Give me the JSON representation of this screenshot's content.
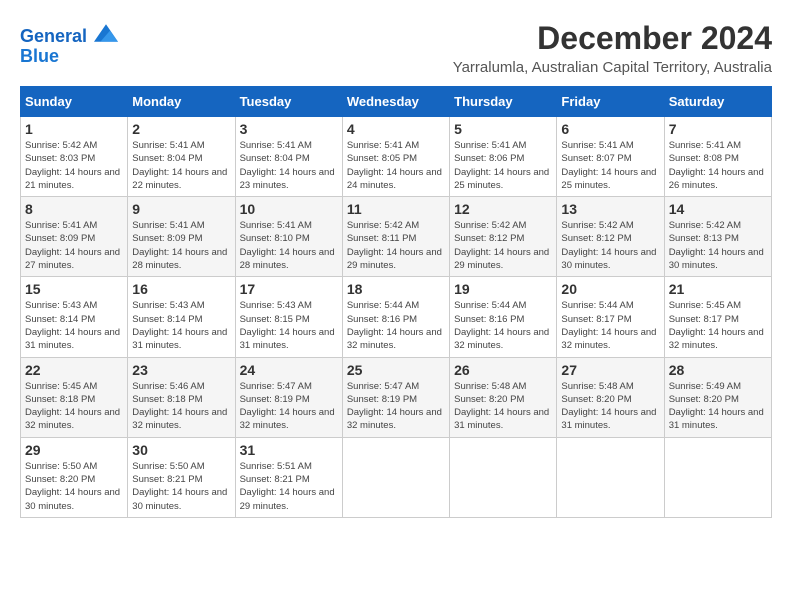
{
  "header": {
    "logo_line1": "General",
    "logo_line2": "Blue",
    "month_title": "December 2024",
    "location": "Yarralumla, Australian Capital Territory, Australia"
  },
  "days_of_week": [
    "Sunday",
    "Monday",
    "Tuesday",
    "Wednesday",
    "Thursday",
    "Friday",
    "Saturday"
  ],
  "weeks": [
    [
      {
        "num": "1",
        "sunrise": "5:42 AM",
        "sunset": "8:03 PM",
        "daylight": "14 hours and 21 minutes."
      },
      {
        "num": "2",
        "sunrise": "5:41 AM",
        "sunset": "8:04 PM",
        "daylight": "14 hours and 22 minutes."
      },
      {
        "num": "3",
        "sunrise": "5:41 AM",
        "sunset": "8:04 PM",
        "daylight": "14 hours and 23 minutes."
      },
      {
        "num": "4",
        "sunrise": "5:41 AM",
        "sunset": "8:05 PM",
        "daylight": "14 hours and 24 minutes."
      },
      {
        "num": "5",
        "sunrise": "5:41 AM",
        "sunset": "8:06 PM",
        "daylight": "14 hours and 25 minutes."
      },
      {
        "num": "6",
        "sunrise": "5:41 AM",
        "sunset": "8:07 PM",
        "daylight": "14 hours and 25 minutes."
      },
      {
        "num": "7",
        "sunrise": "5:41 AM",
        "sunset": "8:08 PM",
        "daylight": "14 hours and 26 minutes."
      }
    ],
    [
      {
        "num": "8",
        "sunrise": "5:41 AM",
        "sunset": "8:09 PM",
        "daylight": "14 hours and 27 minutes."
      },
      {
        "num": "9",
        "sunrise": "5:41 AM",
        "sunset": "8:09 PM",
        "daylight": "14 hours and 28 minutes."
      },
      {
        "num": "10",
        "sunrise": "5:41 AM",
        "sunset": "8:10 PM",
        "daylight": "14 hours and 28 minutes."
      },
      {
        "num": "11",
        "sunrise": "5:42 AM",
        "sunset": "8:11 PM",
        "daylight": "14 hours and 29 minutes."
      },
      {
        "num": "12",
        "sunrise": "5:42 AM",
        "sunset": "8:12 PM",
        "daylight": "14 hours and 29 minutes."
      },
      {
        "num": "13",
        "sunrise": "5:42 AM",
        "sunset": "8:12 PM",
        "daylight": "14 hours and 30 minutes."
      },
      {
        "num": "14",
        "sunrise": "5:42 AM",
        "sunset": "8:13 PM",
        "daylight": "14 hours and 30 minutes."
      }
    ],
    [
      {
        "num": "15",
        "sunrise": "5:43 AM",
        "sunset": "8:14 PM",
        "daylight": "14 hours and 31 minutes."
      },
      {
        "num": "16",
        "sunrise": "5:43 AM",
        "sunset": "8:14 PM",
        "daylight": "14 hours and 31 minutes."
      },
      {
        "num": "17",
        "sunrise": "5:43 AM",
        "sunset": "8:15 PM",
        "daylight": "14 hours and 31 minutes."
      },
      {
        "num": "18",
        "sunrise": "5:44 AM",
        "sunset": "8:16 PM",
        "daylight": "14 hours and 32 minutes."
      },
      {
        "num": "19",
        "sunrise": "5:44 AM",
        "sunset": "8:16 PM",
        "daylight": "14 hours and 32 minutes."
      },
      {
        "num": "20",
        "sunrise": "5:44 AM",
        "sunset": "8:17 PM",
        "daylight": "14 hours and 32 minutes."
      },
      {
        "num": "21",
        "sunrise": "5:45 AM",
        "sunset": "8:17 PM",
        "daylight": "14 hours and 32 minutes."
      }
    ],
    [
      {
        "num": "22",
        "sunrise": "5:45 AM",
        "sunset": "8:18 PM",
        "daylight": "14 hours and 32 minutes."
      },
      {
        "num": "23",
        "sunrise": "5:46 AM",
        "sunset": "8:18 PM",
        "daylight": "14 hours and 32 minutes."
      },
      {
        "num": "24",
        "sunrise": "5:47 AM",
        "sunset": "8:19 PM",
        "daylight": "14 hours and 32 minutes."
      },
      {
        "num": "25",
        "sunrise": "5:47 AM",
        "sunset": "8:19 PM",
        "daylight": "14 hours and 32 minutes."
      },
      {
        "num": "26",
        "sunrise": "5:48 AM",
        "sunset": "8:20 PM",
        "daylight": "14 hours and 31 minutes."
      },
      {
        "num": "27",
        "sunrise": "5:48 AM",
        "sunset": "8:20 PM",
        "daylight": "14 hours and 31 minutes."
      },
      {
        "num": "28",
        "sunrise": "5:49 AM",
        "sunset": "8:20 PM",
        "daylight": "14 hours and 31 minutes."
      }
    ],
    [
      {
        "num": "29",
        "sunrise": "5:50 AM",
        "sunset": "8:20 PM",
        "daylight": "14 hours and 30 minutes."
      },
      {
        "num": "30",
        "sunrise": "5:50 AM",
        "sunset": "8:21 PM",
        "daylight": "14 hours and 30 minutes."
      },
      {
        "num": "31",
        "sunrise": "5:51 AM",
        "sunset": "8:21 PM",
        "daylight": "14 hours and 29 minutes."
      },
      null,
      null,
      null,
      null
    ]
  ],
  "colors": {
    "header_bg": "#1565c0",
    "alt_row_bg": "#f5f5f5"
  }
}
